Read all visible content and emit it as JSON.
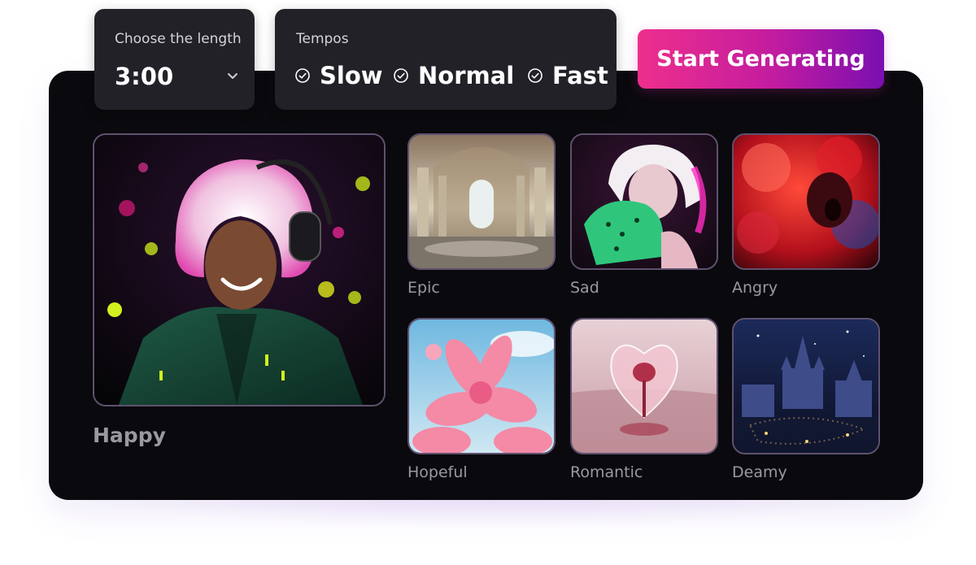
{
  "length": {
    "label": "Choose the length",
    "value": "3:00"
  },
  "tempos": {
    "label": "Tempos",
    "options": [
      "Slow",
      "Normal",
      "Fast"
    ]
  },
  "start_button": "Start Generating",
  "featured": {
    "label": "Happy"
  },
  "moods": [
    {
      "label": "Epic"
    },
    {
      "label": "Sad"
    },
    {
      "label": "Angry"
    },
    {
      "label": "Hopeful"
    },
    {
      "label": "Romantic"
    },
    {
      "label": "Deamy"
    }
  ],
  "colors": {
    "panel": "#0a090d",
    "card": "#222127",
    "button_start": "#ee2f8c",
    "button_end": "#7a0fb0",
    "muted_label": "#9a999f"
  }
}
